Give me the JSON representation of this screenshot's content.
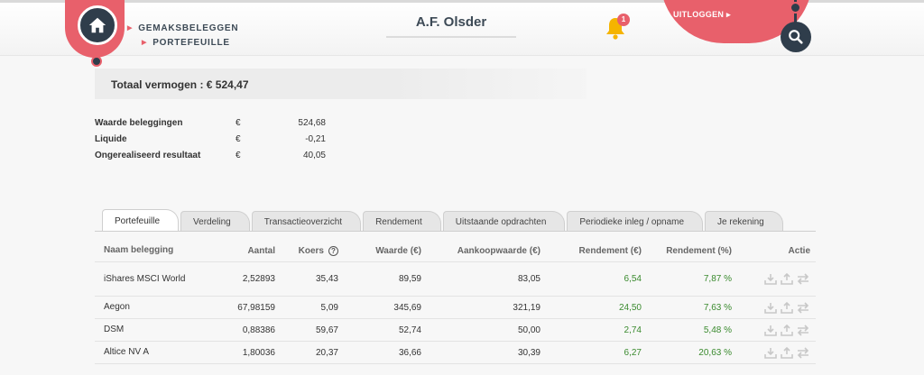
{
  "header": {
    "breadcrumb": [
      "GEMAKSBELEGGEN",
      "PORTEFEUILLE"
    ],
    "username": "A.F. Olsder",
    "notifications": "1",
    "logout": "UITLOGGEN ▸",
    "accent": "#e8606b",
    "dark": "#2f3d4b",
    "bell_color": "#f5b400"
  },
  "summary": {
    "total": "Totaal vermogen : € 524,47",
    "rows": [
      {
        "label": "Waarde beleggingen",
        "currency": "€",
        "value": "524,68"
      },
      {
        "label": "Liquide",
        "currency": "€",
        "value": "-0,21"
      },
      {
        "label": "Ongerealiseerd resultaat",
        "currency": "€",
        "value": "40,05"
      }
    ]
  },
  "tabs": [
    "Portefeuille",
    "Verdeling",
    "Transactieoverzicht",
    "Rendement",
    "Uitstaande opdrachten",
    "Periodieke inleg / opname",
    "Je rekening"
  ],
  "active_tab": "Portefeuille",
  "table": {
    "headers": {
      "name": "Naam belegging",
      "aantal": "Aantal",
      "koers": "Koers",
      "waarde": "Waarde (€)",
      "aankoop": "Aankoopwaarde (€)",
      "rend_eur": "Rendement (€)",
      "rend_pct": "Rendement (%)",
      "actie": "Actie"
    },
    "help_glyph": "?",
    "rows": [
      {
        "name": "iShares MSCI World",
        "aantal": "2,52893",
        "koers": "35,43",
        "waarde": "89,59",
        "aankoop": "83,05",
        "rend_eur": "6,54",
        "rend_pct": "7,87 %"
      },
      {
        "name": "Aegon",
        "aantal": "67,98159",
        "koers": "5,09",
        "waarde": "345,69",
        "aankoop": "321,19",
        "rend_eur": "24,50",
        "rend_pct": "7,63 %"
      },
      {
        "name": "DSM",
        "aantal": "0,88386",
        "koers": "59,67",
        "waarde": "52,74",
        "aankoop": "50,00",
        "rend_eur": "2,74",
        "rend_pct": "5,48 %"
      },
      {
        "name": "Altice NV A",
        "aantal": "1,80036",
        "koers": "20,37",
        "waarde": "36,66",
        "aankoop": "30,39",
        "rend_eur": "6,27",
        "rend_pct": "20,63 %"
      }
    ]
  }
}
